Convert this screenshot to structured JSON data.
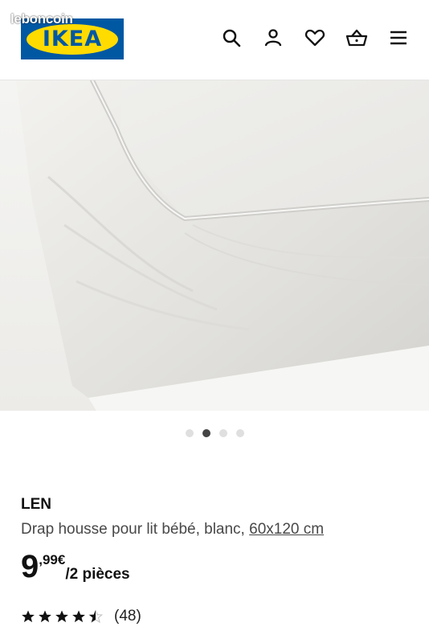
{
  "watermark": "leboncoin",
  "logo": {
    "text": "IKEA",
    "blue": "#0058a3",
    "yellow": "#ffdb00"
  },
  "header_icons": [
    "search-icon",
    "profile-icon",
    "heart-icon",
    "basket-icon",
    "menu-icon"
  ],
  "carousel": {
    "total": 4,
    "active_index": 2
  },
  "product": {
    "name": "LEN",
    "description": "Drap housse pour lit bébé, blanc, ",
    "size": "60x120 cm",
    "price_integer": "9",
    "price_decimal": ",99€",
    "price_unit": "/2 pièces",
    "rating": {
      "stars": 4.5,
      "out_of": 5
    },
    "review_count": "(48)"
  }
}
